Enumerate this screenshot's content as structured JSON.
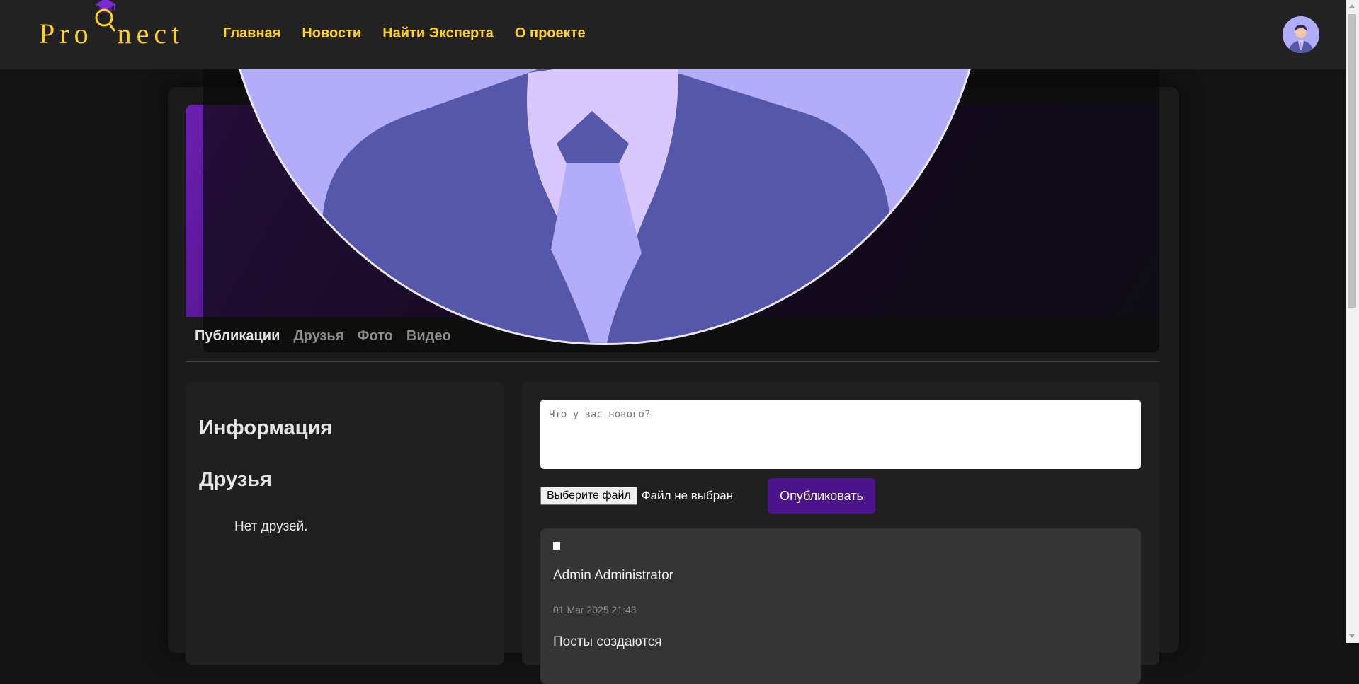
{
  "brand": {
    "logo_text": "ProQnect",
    "color": "#ffd21f",
    "accent": "#4b148c"
  },
  "nav": {
    "items": [
      "Главная",
      "Новости",
      "Найти Эксперта",
      "О проекте"
    ]
  },
  "profile": {
    "tabs": [
      "Публикации",
      "Друзья",
      "Фото",
      "Видео"
    ],
    "active_tab": "Публикации"
  },
  "left": {
    "info_title": "Информация",
    "friends_title": "Друзья",
    "friends_empty": "Нет друзей."
  },
  "composer": {
    "placeholder": "Что у вас нового?",
    "file_button": "Выберите файл",
    "file_status": "Файл не выбран",
    "publish": "Опубликовать"
  },
  "post": {
    "author": "Admin Administrator",
    "date": "01 Mar 2025 21:43",
    "text": "Посты создаются"
  }
}
